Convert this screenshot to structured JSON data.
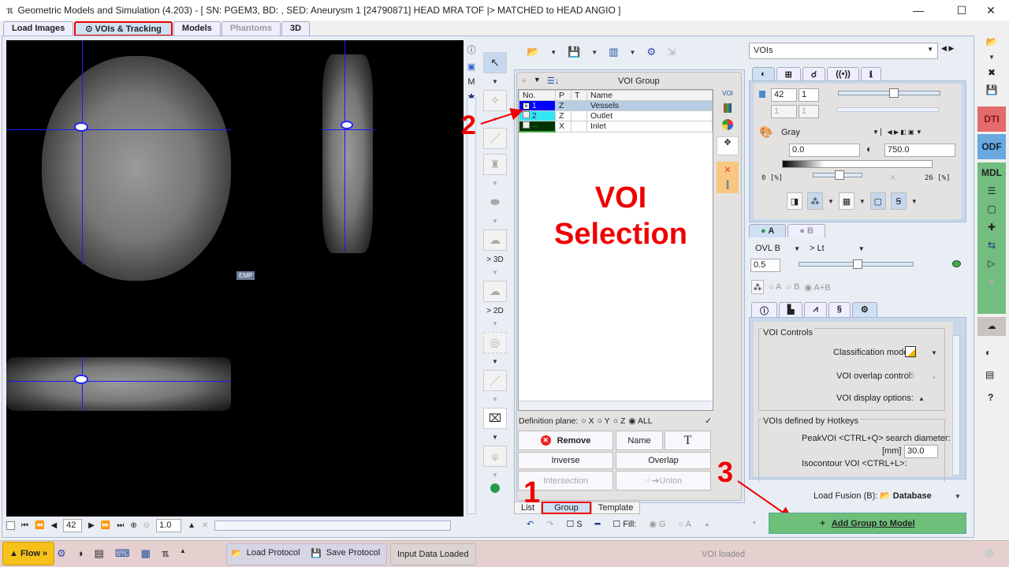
{
  "window": {
    "title": "Geometric Models and Simulation (4.203) - [ SN: PGEM3, BD: , SED: Aneurysm 1 [24790871] HEAD MRA TOF |> MATCHED to HEAD ANGIO ]",
    "minimize": "—",
    "maximize": "☐",
    "close": "✕"
  },
  "tabs": [
    {
      "label": "Load Images"
    },
    {
      "label": "VOIs & Tracking",
      "icon": "⊙"
    },
    {
      "label": "Models"
    },
    {
      "label": "Phantoms"
    },
    {
      "label": "3D"
    }
  ],
  "viewer": {
    "emp_label": "EMP",
    "slice": "42",
    "zoom": "1.0"
  },
  "left_tools": {
    "to3d": "> 3D",
    "to2d": "> 2D",
    "m_label": "M"
  },
  "voi_group": {
    "header": "VOI Group",
    "columns": [
      "No.",
      "P",
      "T",
      "Name"
    ],
    "rows": [
      {
        "no": "1",
        "p": "Z",
        "t": "",
        "name": "Vessels",
        "color": "#0000ff",
        "checked": true
      },
      {
        "no": "2",
        "p": "Z",
        "t": "",
        "name": "Outlet",
        "color": "#33e6f0",
        "checked": false
      },
      {
        "no": "··",
        "p": "X",
        "t": "",
        "name": "Inlet",
        "color": "#003300",
        "checked": false
      }
    ],
    "side_voi": "VOI",
    "definition_plane": "Definition plane:",
    "planes": [
      "X",
      "Y",
      "Z",
      "ALL"
    ],
    "selected_plane": "ALL",
    "buttons": {
      "remove": "Remove",
      "name": "Name",
      "text": "T",
      "inverse": "Inverse",
      "overlap": "Overlap",
      "intersection": "Intersection",
      "union": "Union"
    },
    "subtabs": [
      "List",
      "Group",
      "Template"
    ],
    "bottom": {
      "s": "S",
      "fill": "Fill:",
      "g": "G",
      "a": "A"
    }
  },
  "annotations": {
    "big_title_1": "VOI",
    "big_title_2": "Selection",
    "n1": "1",
    "n2": "2",
    "n3": "3"
  },
  "right": {
    "select": "VOIs",
    "value1": "42",
    "value2": "1",
    "value3": "1",
    "value4": "1",
    "colormap": "Gray",
    "min": "0.0",
    "max": "750.0",
    "pct_left": "0 [%]",
    "pct_right": "26 [%]",
    "fusion_tabs": [
      "A",
      "B"
    ],
    "ovl": "OVL  B",
    "lt": "> Lt",
    "blend": "0.5",
    "radios": [
      "A",
      "B",
      "A+B"
    ],
    "voi_controls": "VOI Controls",
    "classification": "Classification mode:",
    "overlap_ctrl": "VOI overlap control:",
    "display_opts": "VOI display options:",
    "hotkeys": "VOIs defined by Hotkeys",
    "peak": "PeakVOI <CTRL+Q> search diameter:",
    "mm": "[mm]",
    "diameter": "30.0",
    "iso": "Isocontour VOI <CTRL+L>:",
    "load_fusion": "Load Fusion (B):",
    "database": "Database",
    "add_group": "Add Group to Model",
    "add_icon": "+"
  },
  "sidebar": {
    "dti": "DTI",
    "odf": "ODF",
    "mdl": "MDL",
    "help": "?"
  },
  "status": {
    "flow": "▲ Flow »",
    "load_protocol": "Load Protocol",
    "save_protocol": "Save Protocol",
    "input_loaded": "Input Data Loaded",
    "message": "VOI loaded"
  },
  "colors": {
    "red_annotation": "#e00000",
    "add_button": "#6dbf7a",
    "dti": "#e46b6b",
    "odf": "#6aa8e0",
    "mdl": "#73bd80",
    "flow": "#f6c21a",
    "status_bg": "#e6cfcf"
  }
}
